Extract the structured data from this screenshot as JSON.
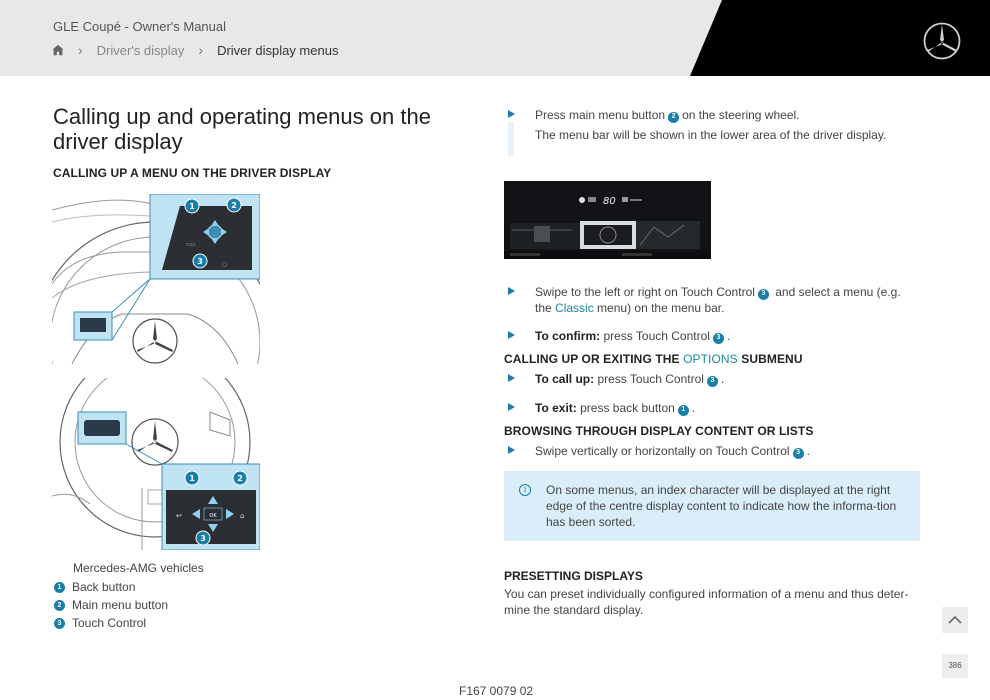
{
  "header": {
    "title": "GLE Coupé - Owner's Manual",
    "breadcrumb": [
      "Driver's display",
      "Driver display menus"
    ]
  },
  "page": {
    "heading": "Calling up and operating menus on the driver display",
    "section1": "CALLING UP A MENU ON THE DRIVER DISPLAY",
    "illustration_labels": {
      "one": "1",
      "two": "2",
      "three": "3",
      "back": "BACK",
      "ok": "OK"
    },
    "dash_readout": "80",
    "caption": "Mercedes-AMG vehicles",
    "legend": [
      {
        "num": "1",
        "label": "Back button"
      },
      {
        "num": "2",
        "label": "Main menu button"
      },
      {
        "num": "3",
        "label": "Touch Control"
      }
    ]
  },
  "steps": {
    "s1_a": "Press main menu button",
    "s1_num": "2",
    "s1_b": "on the steering wheel.",
    "s1_result": "The menu bar will be shown in the lower area of the driver display.",
    "s2_a": "Swipe to the left or right on Touch Control",
    "s2_num": "3",
    "s2_b": "and select a menu (e.g.",
    "s2_c": "the",
    "s2_classic": "Classic",
    "s2_d": "menu) on the menu bar.",
    "s3_bold": "To confirm:",
    "s3_text": "press Touch Control",
    "s3_num": "3",
    "section2_a": "CALLING UP OR EXITING THE",
    "section2_options": "OPTIONS",
    "section2_b": "SUBMENU",
    "s4_bold": "To call up:",
    "s4_text": "press Touch Control",
    "s4_num": "3",
    "s5_bold": "To exit:",
    "s5_text": "press back button",
    "s5_num": "1",
    "section3": "BROWSING THROUGH DISPLAY CONTENT OR LISTS",
    "s6_text": "Swipe vertically or horizontally on Touch Control",
    "s6_num": "3"
  },
  "info": {
    "icon": "i",
    "text": "On some menus, an index character will be displayed at the right edge of the centre display content to indicate how the informa-tion has been sorted."
  },
  "preset": {
    "heading": "PRESETTING DISPLAYS",
    "text": "You can preset individually configured information of a menu and thus deter-mine the standard display."
  },
  "footer": {
    "image_code": "F167 0079 02",
    "page_label": "386"
  },
  "colors": {
    "accent": "#1a7ea8",
    "teal_text": "#1a8a9a",
    "header_bg": "#e8e8e8",
    "info_bg": "#d9eef8"
  }
}
